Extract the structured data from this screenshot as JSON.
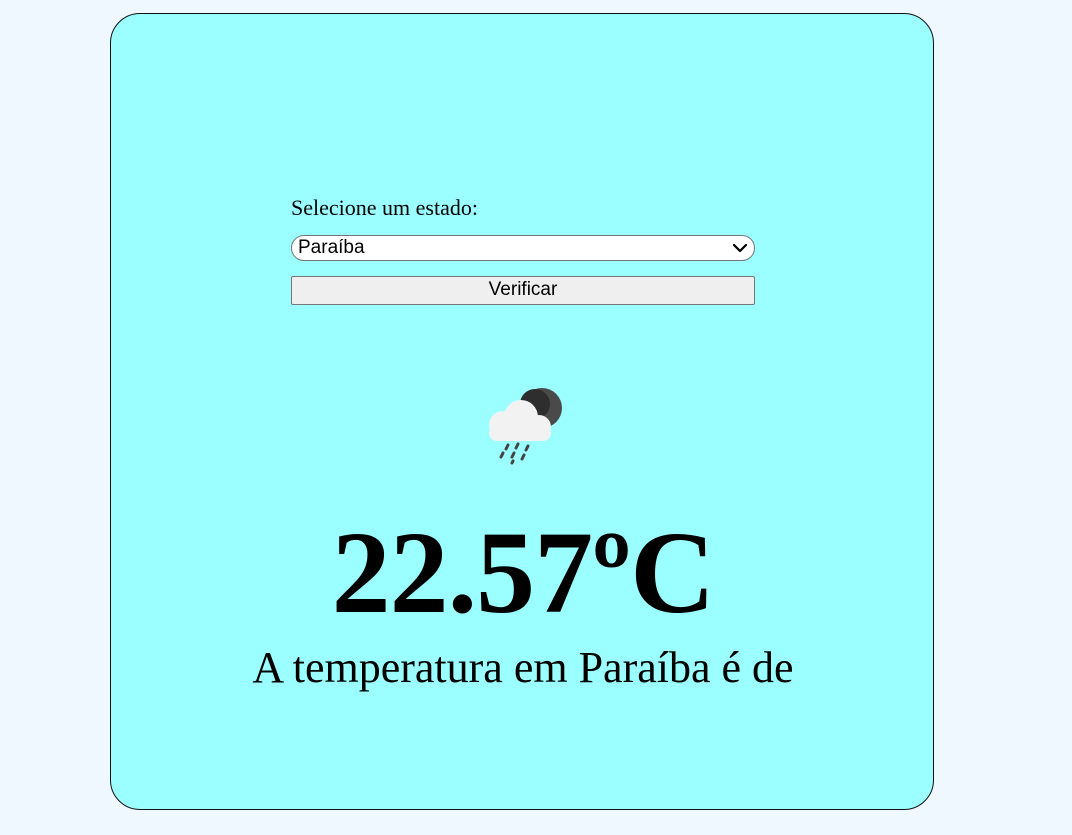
{
  "form": {
    "label": "Selecione um estado:",
    "selected_state": "Paraíba",
    "button_label": "Verificar"
  },
  "weather": {
    "icon": "cloud-moon-rain-icon",
    "temperature": "22.57ºC",
    "description": "A temperatura em Paraíba é de"
  },
  "colors": {
    "page_background": "#f0f8ff",
    "card_background": "#9bffff"
  }
}
